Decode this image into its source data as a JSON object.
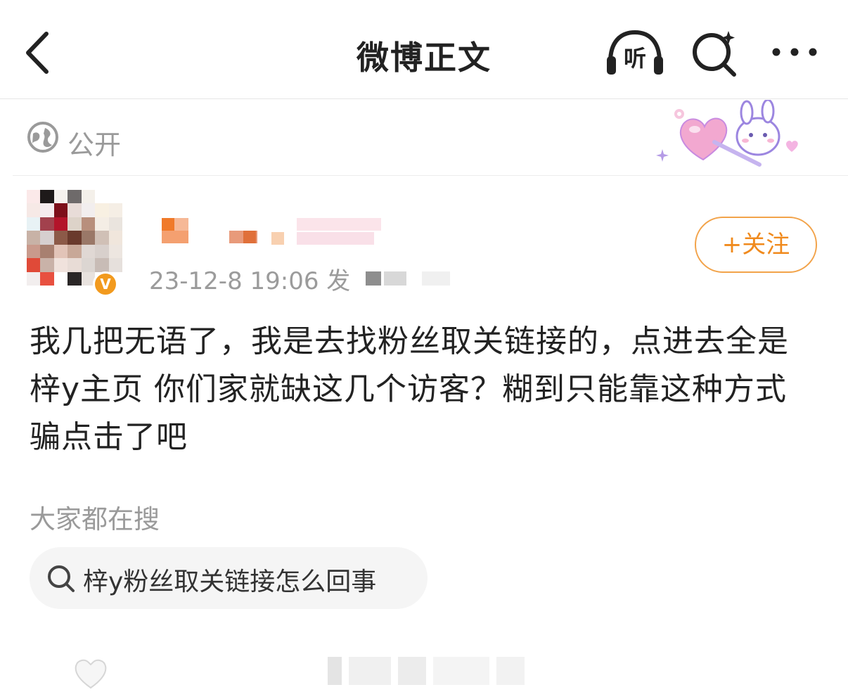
{
  "navbar": {
    "title": "微博正文",
    "listen_label": "听"
  },
  "post": {
    "visibility": "公开",
    "author": {
      "verified_badge": "V"
    },
    "meta_text": "23-12-8 19:06  发",
    "follow_label": "+关注",
    "content": "我几把无语了，我是去找粉丝取关链接的，点进去全是梓y主页 你们家就缺这几个访客？糊到只能靠这种方式骗点击了吧"
  },
  "trending": {
    "title": "大家都在搜",
    "query": "梓y粉丝取关链接怎么回事"
  },
  "icons": {
    "back": "chevron-left-icon",
    "listen": "headphones-icon",
    "search": "search-sparkle-icon",
    "more": "more-dots-icon",
    "visibility": "globe-icon",
    "like": "heart-icon"
  },
  "colors": {
    "accent_orange": "#f08a1d",
    "follow_border": "#f2a34a",
    "muted_text": "#9a9a9a",
    "chip_bg": "#f5f5f5"
  }
}
